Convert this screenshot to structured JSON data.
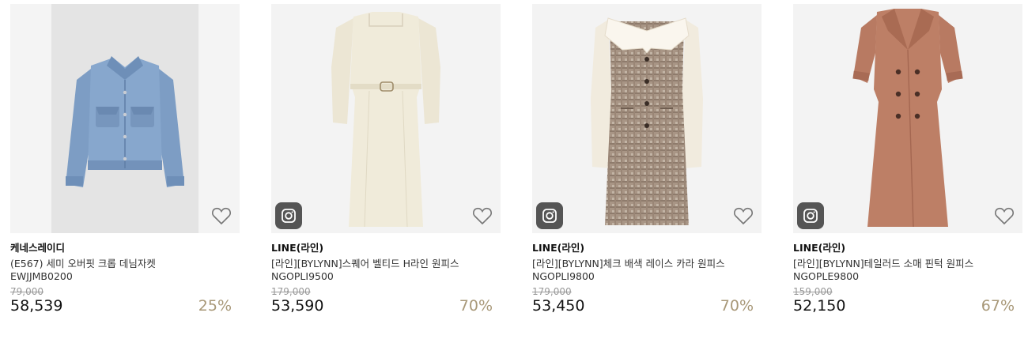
{
  "colors": {
    "discount": "#a89878",
    "original_price": "#999999",
    "image_bg": "#f3f3f3",
    "instagram_badge": "#555555"
  },
  "products": [
    {
      "brand": "케네스레이디",
      "name": "(E567) 세미 오버핏 크롭 데님자켓",
      "code": "EWJJMB0200",
      "original_price": "79,000",
      "price": "58,539",
      "discount": "25%",
      "image": "denim-jacket",
      "has_instagram_badge": false
    },
    {
      "brand": "LINE(라인)",
      "name": "[라인][BYLYNN]스퀘어 벨티드 H라인 원피스",
      "code": "NGOPLI9500",
      "original_price": "179,000",
      "price": "53,590",
      "discount": "70%",
      "image": "cream-belted-dress",
      "has_instagram_badge": true
    },
    {
      "brand": "LINE(라인)",
      "name": "[라인][BYLYNN]체크 배색 레이스 카라 원피스",
      "code": "NGOPLI9800",
      "original_price": "179,000",
      "price": "53,450",
      "discount": "70%",
      "image": "check-collar-dress",
      "has_instagram_badge": true
    },
    {
      "brand": "LINE(라인)",
      "name": "[라인][BYLYNN]테일러드 소매 핀턱 원피스",
      "code": "NGOPLE9800",
      "original_price": "159,000",
      "price": "52,150",
      "discount": "67%",
      "image": "tailored-brown-dress",
      "has_instagram_badge": true
    }
  ],
  "icons": {
    "wishlist": "heart-outline-icon",
    "instagram": "instagram-icon"
  }
}
